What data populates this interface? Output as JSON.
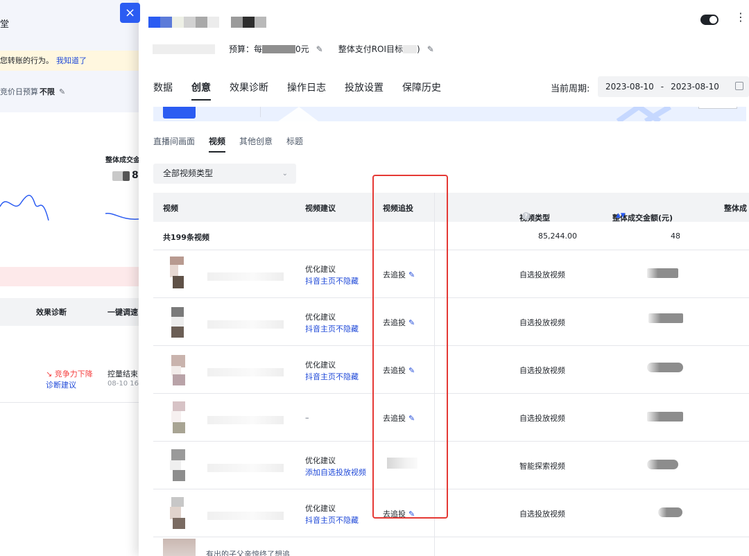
{
  "background_page": {
    "title_fragment": "堂",
    "notice_text": "您转账的行为。",
    "notice_link": "我知道了",
    "budget_label": "竞价日预算",
    "budget_value": "不限",
    "metric_label": "整体成交金",
    "metric_value_fragment": "8",
    "table_headers": [
      "效果诊断",
      "一键调速"
    ],
    "row": {
      "status": "竞争力下降",
      "status_link": "诊断建议",
      "volume": "控量结束",
      "time": "08-10 16:"
    }
  },
  "close_icon": "×",
  "header": {
    "budget_label": "预算：每",
    "budget_suffix": "0元",
    "roi_label": "整体支付ROI目标",
    "roi_suffix": ")",
    "edit_icon": "✎",
    "more_icon": "⋮"
  },
  "tabs": [
    {
      "label": "数据"
    },
    {
      "label": "创意"
    },
    {
      "label": "效果诊断"
    },
    {
      "label": "操作日志"
    },
    {
      "label": "投放设置"
    },
    {
      "label": "保障历史"
    }
  ],
  "active_tab": "创意",
  "period": {
    "label": "当前周期:",
    "start": "2023-08-10",
    "separator": "-",
    "end": "2023-08-10"
  },
  "sub_tabs": [
    {
      "label": "直播间画面"
    },
    {
      "label": "视频"
    },
    {
      "label": "其他创意"
    },
    {
      "label": "标题"
    }
  ],
  "active_sub_tab": "视频",
  "filter": {
    "selected": "全部视频类型",
    "chevron": "⌄"
  },
  "table": {
    "headers": {
      "video": "视频",
      "suggestion": "视频建议",
      "chase": "视频追投",
      "video_type": "视频类型",
      "help_icon": "?",
      "gmv": "整体成交金额(元)",
      "sort_icon": "▲▼",
      "next": "整体成"
    },
    "summary": {
      "count": "共199条视频",
      "value_a": "85,244.00",
      "value_b": "48"
    },
    "rows": [
      {
        "suggest_title": "优化建议",
        "suggest_link": "抖音主页不隐藏",
        "chase": "去追投",
        "type": "自选投放视频"
      },
      {
        "suggest_title": "优化建议",
        "suggest_link": "抖音主页不隐藏",
        "chase": "去追投",
        "type": "自选投放视频"
      },
      {
        "suggest_title": "优化建议",
        "suggest_link": "抖音主页不隐藏",
        "chase": "去追投",
        "type": "自选投放视频"
      },
      {
        "suggest_title": "",
        "suggest_link": "",
        "dash": "–",
        "chase": "去追投",
        "type": "自选投放视频"
      },
      {
        "suggest_title": "优化建议",
        "suggest_link": "添加自选投放视频",
        "chase": "",
        "type": "智能探索视频"
      },
      {
        "suggest_title": "优化建议",
        "suggest_link": "抖音主页不隐藏",
        "chase": "去追投",
        "type": "自选投放视频"
      }
    ],
    "pen_icon": "✎",
    "last_row_text": "有出的子父亲惊终了想追"
  },
  "colors": {
    "accent": "#2b5cf2",
    "link": "#1f49d8",
    "highlight_box": "#e53935",
    "warning_red": "#f53f3f"
  }
}
